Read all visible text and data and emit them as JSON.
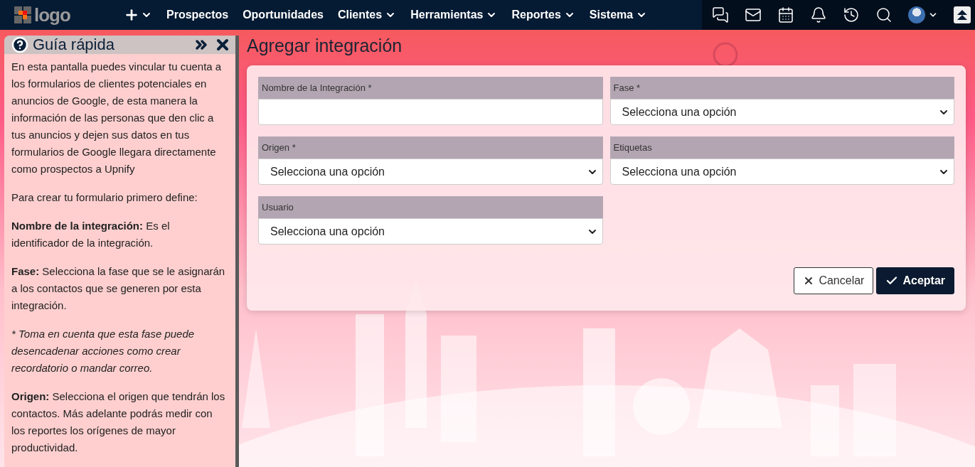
{
  "navbar": {
    "logo": "logo",
    "items": [
      {
        "label": "Prospectos",
        "dropdown": false
      },
      {
        "label": "Oportunidades",
        "dropdown": false
      },
      {
        "label": "Clientes",
        "dropdown": true
      },
      {
        "label": "Herramientas",
        "dropdown": true
      },
      {
        "label": "Reportes",
        "dropdown": true
      },
      {
        "label": "Sistema",
        "dropdown": true
      }
    ]
  },
  "guide": {
    "title": "Guía rápida",
    "paragraphs": [
      {
        "kind": "text",
        "text": "En esta pantalla puedes vincular tu cuenta a los formularios de clientes potenciales en anuncios de Google, de esta manera la información de las personas que den clic a tus anuncios y dejen sus datos en tus formularios de Google llegara directamente como prospectos a Upnify"
      },
      {
        "kind": "text",
        "text": "Para crear tu formulario primero define:"
      },
      {
        "kind": "text",
        "text": "**Nombre de la integración:** Es el identificador de la integración."
      },
      {
        "kind": "text",
        "text": "**Fase:** Selecciona la fase que se le asignarán a los contactos que se generen por esta integración."
      },
      {
        "kind": "note",
        "text": "* Toma en cuenta que esta fase puede desencadenar acciones como crear recordatorio o mandar correo."
      },
      {
        "kind": "text",
        "text": "**Origen:** Selecciona el origen que tendrán los contactos. Más adelante podrás medir con los reportes los orígenes de mayor productividad."
      }
    ]
  },
  "page": {
    "title": "Agregar integración"
  },
  "form": {
    "fields": [
      {
        "kind": "text",
        "label": "Nombre de la Integración *"
      },
      {
        "kind": "select",
        "label": "Fase *",
        "value": "Selecciona una opción"
      },
      {
        "kind": "select",
        "label": "Origen *",
        "value": "Selecciona una opción"
      },
      {
        "kind": "select",
        "label": "Etiquetas",
        "value": "Selecciona una opción"
      },
      {
        "kind": "select",
        "label": "Usuario",
        "value": "Selecciona una opción"
      }
    ],
    "buttons": [
      {
        "kind": "secondary",
        "label": "Cancelar"
      },
      {
        "kind": "primary",
        "label": "Aceptar"
      }
    ]
  }
}
